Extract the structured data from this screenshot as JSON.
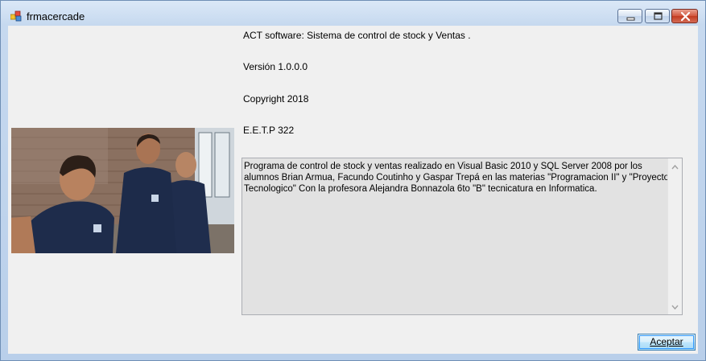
{
  "window": {
    "title": "frmacercade",
    "controls": [
      "minimize-icon",
      "maximize-icon",
      "close-icon"
    ]
  },
  "info": {
    "product": "ACT software: Sistema de control de stock y Ventas .",
    "version": "Versión 1.0.0.0",
    "copyright": "Copyright 2018",
    "company": "E.E.T.P 322"
  },
  "description": "Programa de control de stock y ventas realizado en Visual Basic 2010 y SQL Server 2008 por los alumnos Brian Armua, Facundo Coutinho y Gaspar Trepá en las materias \"Programacion II\" y \"Proyecto Tecnologico\" Con la profesora Alejandra Bonnazola 6to \"B\" tecnicatura en Informatica.",
  "buttons": {
    "ok_label": "Aceptar"
  },
  "photo": {
    "subject": "three students group photo",
    "icon": "photo-image"
  },
  "colors": {
    "client_bg": "#f0f0f0",
    "textbox_bg": "#e2e2e2",
    "close_button": "#c23b22"
  }
}
